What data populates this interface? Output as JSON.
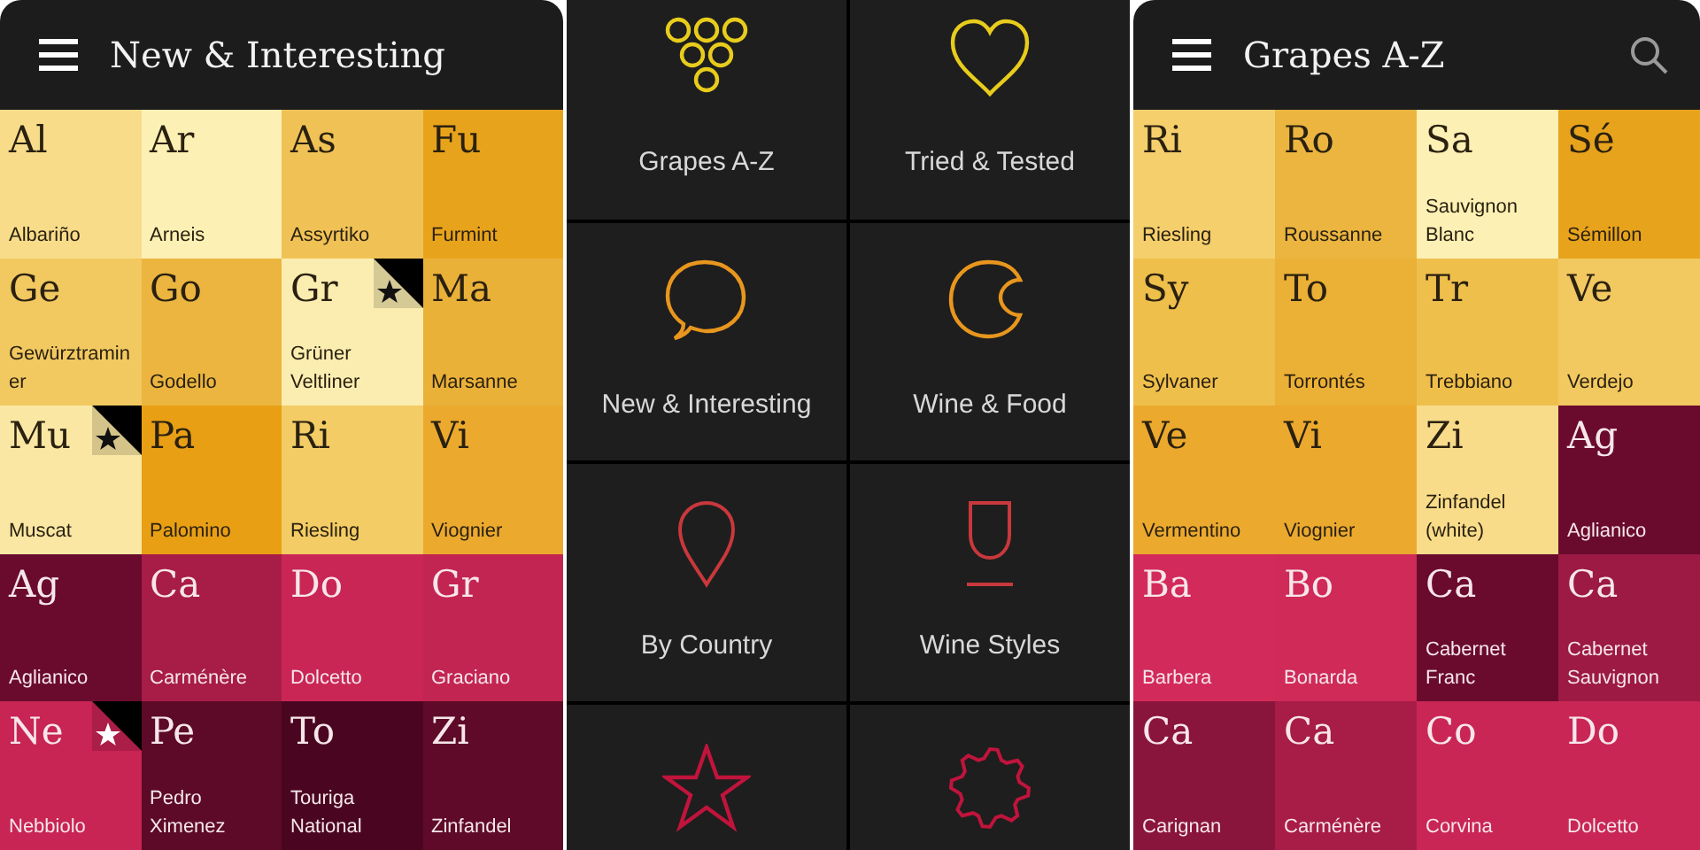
{
  "screens": [
    {
      "kind": "grid",
      "header": {
        "title": "New & Interesting",
        "search": false
      },
      "tiles": [
        {
          "symbol": "Al",
          "name": "Albariño",
          "kind": "white",
          "color": "#f8dc8a",
          "starred": false
        },
        {
          "symbol": "Ar",
          "name": "Arneis",
          "kind": "white",
          "color": "#fdf0b4",
          "starred": false
        },
        {
          "symbol": "As",
          "name": "Assyrtiko",
          "kind": "white",
          "color": "#f0c256",
          "starred": false
        },
        {
          "symbol": "Fu",
          "name": "Furmint",
          "kind": "white",
          "color": "#e8a31c",
          "starred": false
        },
        {
          "symbol": "Ge",
          "name": "Gewürztraminer",
          "kind": "white",
          "color": "#f2c860",
          "starred": false
        },
        {
          "symbol": "Go",
          "name": "Godello",
          "kind": "white",
          "color": "#ebb540",
          "starred": false
        },
        {
          "symbol": "Gr",
          "name": "Grüner Veltliner",
          "kind": "white",
          "color": "#fbedb0",
          "starred": true
        },
        {
          "symbol": "Ma",
          "name": "Marsanne",
          "kind": "white",
          "color": "#eab139",
          "starred": false
        },
        {
          "symbol": "Mu",
          "name": "Muscat",
          "kind": "white",
          "color": "#fae7a3",
          "starred": true
        },
        {
          "symbol": "Pa",
          "name": "Palomino",
          "kind": "white",
          "color": "#e89f14",
          "starred": false
        },
        {
          "symbol": "Ri",
          "name": "Riesling",
          "kind": "white",
          "color": "#f3cc65",
          "starred": false
        },
        {
          "symbol": "Vi",
          "name": "Viognier",
          "kind": "white",
          "color": "#eba92e",
          "starred": false
        },
        {
          "symbol": "Ag",
          "name": "Aglianico",
          "kind": "red",
          "color": "#6a0b2e",
          "starred": false
        },
        {
          "symbol": "Ca",
          "name": "Carménère",
          "kind": "red",
          "color": "#a81c48",
          "starred": false
        },
        {
          "symbol": "Do",
          "name": "Dolcetto",
          "kind": "red",
          "color": "#c92656",
          "starred": false
        },
        {
          "symbol": "Gr",
          "name": "Graciano",
          "kind": "red",
          "color": "#c32552",
          "starred": false
        },
        {
          "symbol": "Ne",
          "name": "Nebbiolo",
          "kind": "red",
          "color": "#c82454",
          "starred": true
        },
        {
          "symbol": "Pe",
          "name": "Pedro Ximenez",
          "kind": "red",
          "color": "#5c0a27",
          "starred": false
        },
        {
          "symbol": "To",
          "name": "Touriga National",
          "kind": "red",
          "color": "#4a0620",
          "starred": false
        },
        {
          "symbol": "Zi",
          "name": "Zinfandel",
          "kind": "red",
          "color": "#5e0a28",
          "starred": false
        }
      ]
    },
    {
      "kind": "menu",
      "items": [
        {
          "kind": "grapes",
          "label": "Grapes A-Z",
          "color": "#e8cc1c"
        },
        {
          "kind": "heart",
          "label": "Tried & Tested",
          "color": "#e8cc1c"
        },
        {
          "kind": "bubble",
          "label": "New & Interesting",
          "color": "#e8961e"
        },
        {
          "kind": "crescent",
          "label": "Wine & Food",
          "color": "#e8961e"
        },
        {
          "kind": "pin",
          "label": "By Country",
          "color": "#c8383c"
        },
        {
          "kind": "glass",
          "label": "Wine Styles",
          "color": "#c8383c"
        },
        {
          "kind": "star",
          "color": "#c0143c"
        },
        {
          "kind": "gear",
          "color": "#c0143c"
        }
      ]
    },
    {
      "kind": "grid",
      "header": {
        "title": "Grapes A-Z",
        "search": true
      },
      "tiles": [
        {
          "symbol": "Ri",
          "name": "Riesling",
          "kind": "white",
          "color": "#f5cf6c",
          "starred": false
        },
        {
          "symbol": "Ro",
          "name": "Roussanne",
          "kind": "white",
          "color": "#ebb540",
          "starred": false
        },
        {
          "symbol": "Sa",
          "name": "Sauvignon Blanc",
          "kind": "white",
          "color": "#fdf0b4",
          "starred": false
        },
        {
          "symbol": "Sé",
          "name": "Sémillon",
          "kind": "white",
          "color": "#e8a31c",
          "starred": false
        },
        {
          "symbol": "Sy",
          "name": "Sylvaner",
          "kind": "white",
          "color": "#efbf4c",
          "starred": false
        },
        {
          "symbol": "To",
          "name": "Torrontés",
          "kind": "white",
          "color": "#ebb036",
          "starred": false
        },
        {
          "symbol": "Tr",
          "name": "Trebbiano",
          "kind": "white",
          "color": "#efbf4c",
          "starred": false
        },
        {
          "symbol": "Ve",
          "name": "Verdejo",
          "kind": "white",
          "color": "#f2c860",
          "starred": false
        },
        {
          "symbol": "Ve",
          "name": "Vermentino",
          "kind": "white",
          "color": "#eba92e",
          "starred": false
        },
        {
          "symbol": "Vi",
          "name": "Viognier",
          "kind": "white",
          "color": "#eba92e",
          "starred": false
        },
        {
          "symbol": "Zi",
          "name": "Zinfandel (white)",
          "kind": "white",
          "color": "#f8dc8a",
          "starred": false
        },
        {
          "symbol": "Ag",
          "name": "Aglianico",
          "kind": "red",
          "color": "#6a0b2e",
          "starred": false
        },
        {
          "symbol": "Ba",
          "name": "Barbera",
          "kind": "red",
          "color": "#d22a5a",
          "starred": false
        },
        {
          "symbol": "Bo",
          "name": "Bonarda",
          "kind": "red",
          "color": "#cf2a58",
          "starred": false
        },
        {
          "symbol": "Ca",
          "name": "Cabernet Franc",
          "kind": "red",
          "color": "#6a0b2e",
          "starred": false
        },
        {
          "symbol": "Ca",
          "name": "Cabernet Sauvignon",
          "kind": "red",
          "color": "#9c1a44",
          "starred": false
        },
        {
          "symbol": "Ca",
          "name": "Carignan",
          "kind": "red",
          "color": "#8a153c",
          "starred": false
        },
        {
          "symbol": "Ca",
          "name": "Carménère",
          "kind": "red",
          "color": "#a81c48",
          "starred": false
        },
        {
          "symbol": "Co",
          "name": "Corvina",
          "kind": "red",
          "color": "#c92656",
          "starred": false
        },
        {
          "symbol": "Do",
          "name": "Dolcetto",
          "kind": "red",
          "color": "#c92656",
          "starred": false
        }
      ]
    }
  ]
}
